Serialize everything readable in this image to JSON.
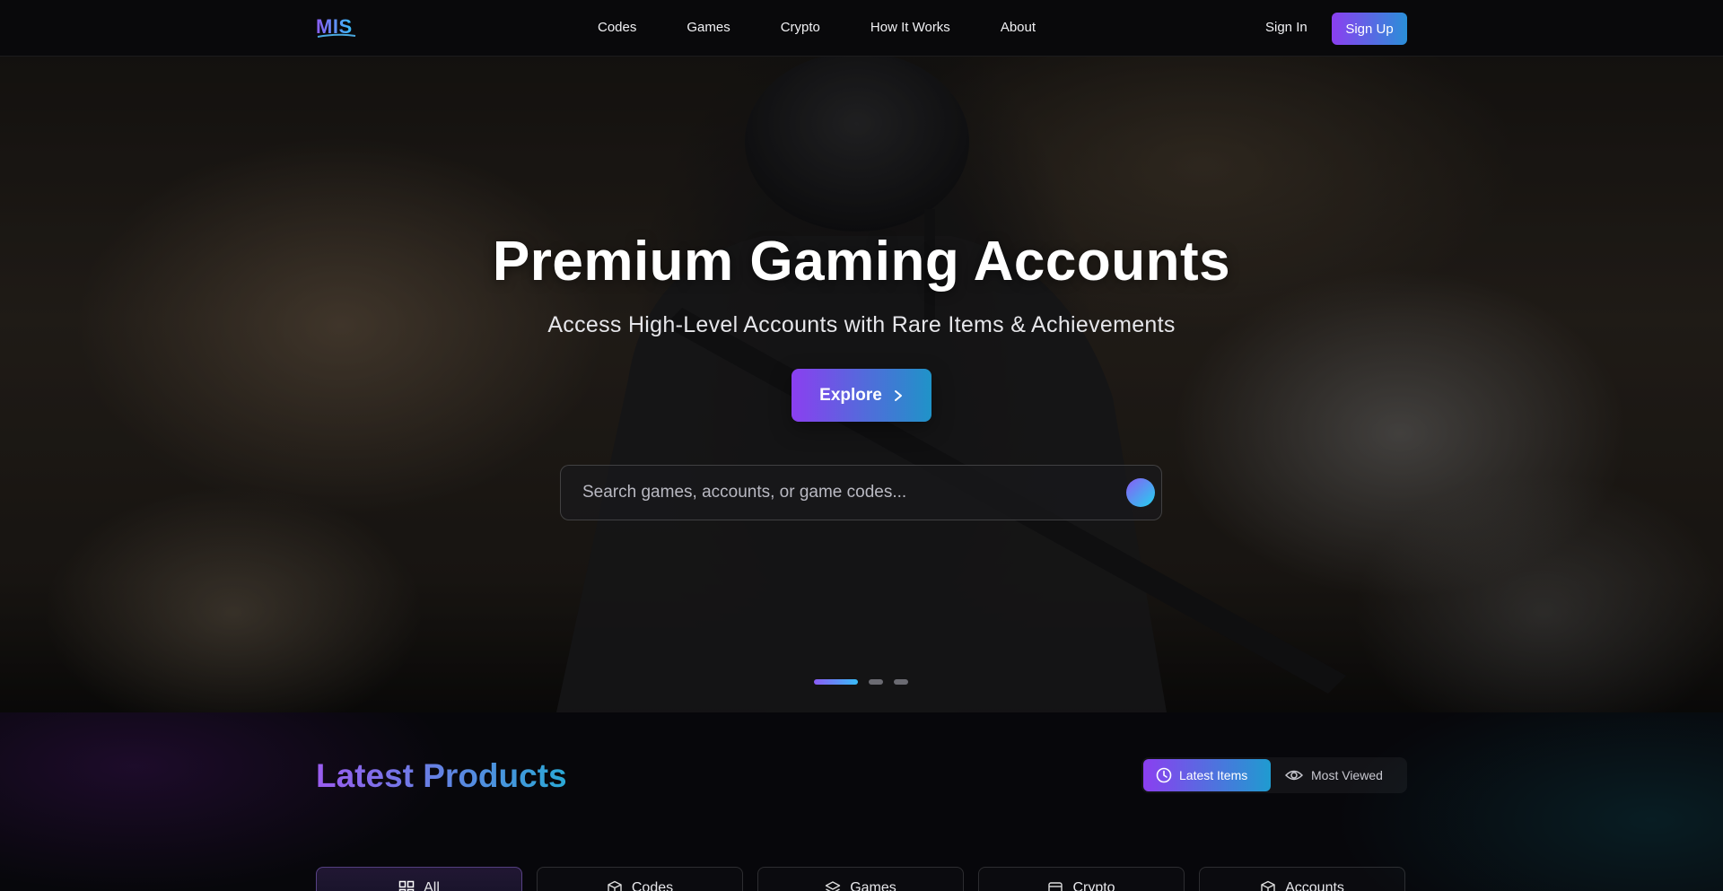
{
  "brand": {
    "logo_text": "MIS"
  },
  "nav": {
    "links": [
      "Codes",
      "Games",
      "Crypto",
      "How It Works",
      "About"
    ],
    "sign_in": "Sign In",
    "sign_up": "Sign Up"
  },
  "hero": {
    "title": "Premium Gaming Accounts",
    "subtitle": "Access High-Level Accounts with Rare Items & Achievements",
    "explore_label": "Explore",
    "search_placeholder": "Search games, accounts, or game codes...",
    "slides": {
      "count": 3,
      "active_index": 0
    }
  },
  "products": {
    "title": "Latest Products",
    "toggle": {
      "latest": "Latest Items",
      "most_viewed": "Most Viewed",
      "active": "latest"
    },
    "categories": [
      {
        "label": "All",
        "icon": "grid-icon",
        "active": true
      },
      {
        "label": "Codes",
        "icon": "box-icon",
        "active": false
      },
      {
        "label": "Games",
        "icon": "layers-icon",
        "active": false
      },
      {
        "label": "Crypto",
        "icon": "wallet-icon",
        "active": false
      },
      {
        "label": "Accounts",
        "icon": "box-icon",
        "active": false
      }
    ]
  },
  "colors": {
    "accent_start": "#8b3ff0",
    "accent_end": "#1f93c8",
    "background": "#07070b"
  }
}
